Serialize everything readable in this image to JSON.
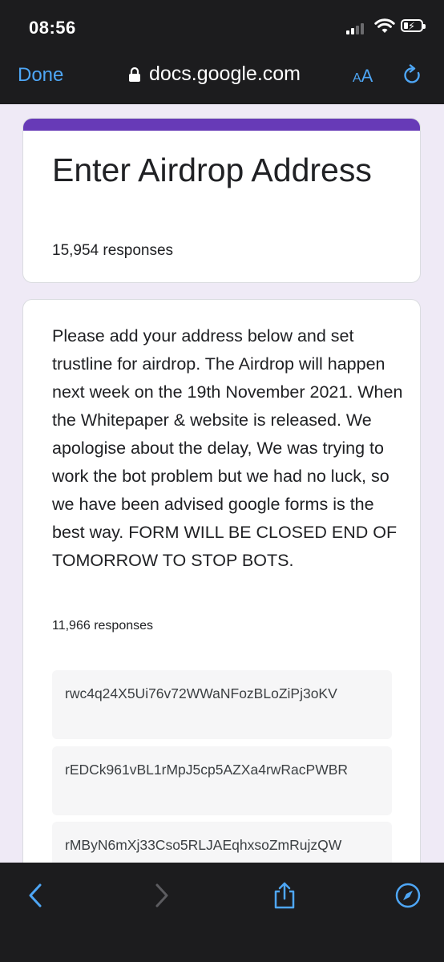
{
  "status_bar": {
    "time": "08:56"
  },
  "browser": {
    "done_label": "Done",
    "url": "docs.google.com",
    "text_size_label_small": "A",
    "text_size_label_large": "A",
    "accent_color": "#4ea6f5"
  },
  "form": {
    "title": "Enter Airdrop Address",
    "responses": "15,954 responses",
    "accent_color": "#673ab7"
  },
  "question": {
    "description": "Please add your address below and set trustline for airdrop. The Airdrop will happen next week on the 19th November 2021. When the Whitepaper & website is released. We apologise about the delay, We was trying to work the bot problem but we had no luck, so we have been advised google forms is the best way. FORM WILL BE CLOSED END OF TOMORROW TO STOP BOTS.",
    "responses": "11,966 responses",
    "answers": [
      "rwc4q24X5Ui76v72WWaNFozBLoZiPj3oKV",
      "rEDCk961vBL1rMpJ5cp5AZXa4rwRacPWBR",
      "rMByN6mXj33Cso5RLJAEqhxsoZmRujzQW"
    ]
  },
  "toolbar": {
    "icons": [
      "back-icon",
      "forward-icon",
      "share-icon",
      "compass-icon"
    ]
  }
}
